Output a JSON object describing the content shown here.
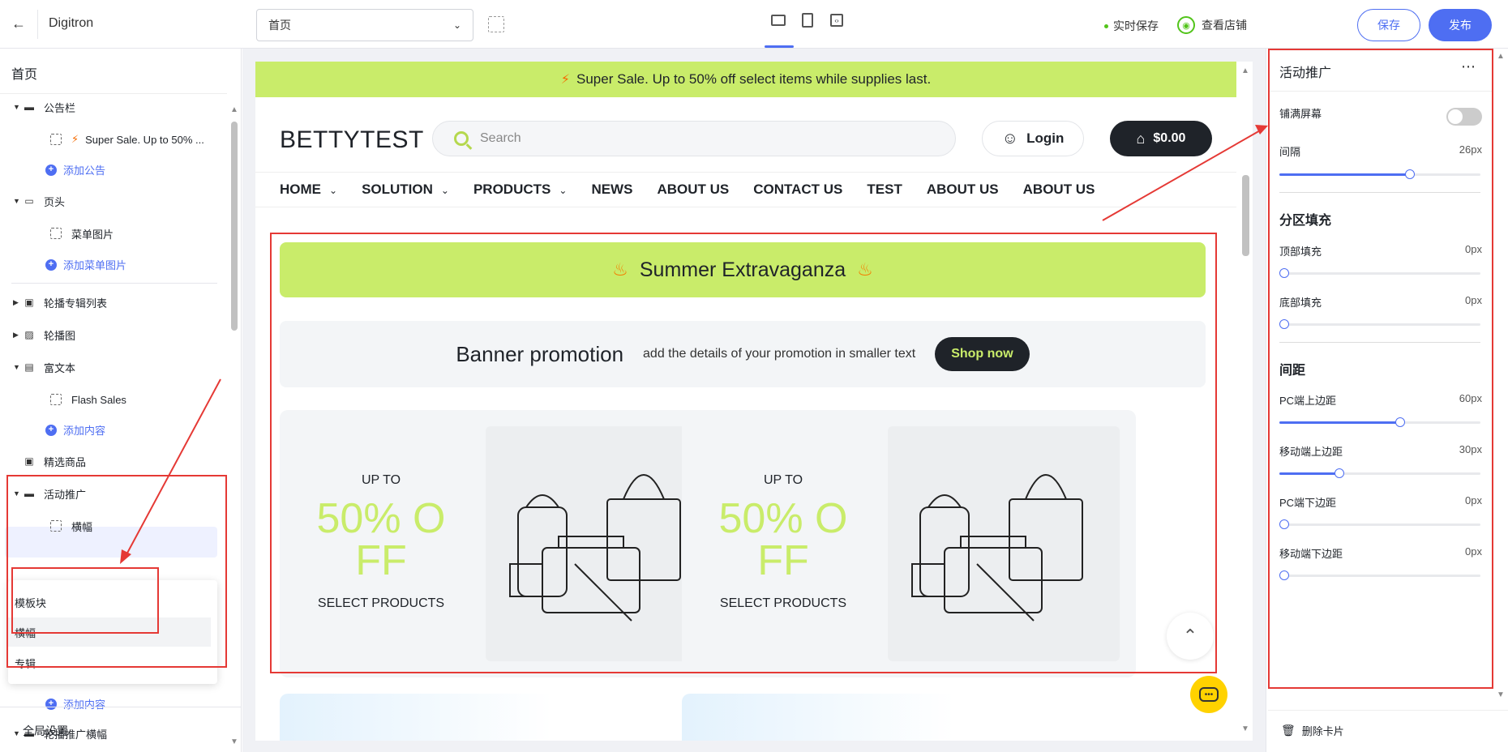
{
  "app": {
    "title": "Digitron"
  },
  "topbar": {
    "page_select": "首页",
    "realtime_save": "实时保存",
    "view_store": "查看店铺",
    "save": "保存",
    "publish": "发布"
  },
  "left": {
    "title": "首页",
    "items": {
      "announcement": "公告栏",
      "announcement_child": "Super Sale. Up to 50% ...",
      "add_announcement": "添加公告",
      "header": "页头",
      "menu_image": "菜单图片",
      "add_menu_image": "添加菜单图片",
      "carousel_album_list": "轮播专辑列表",
      "carousel": "轮播图",
      "rich_text": "富文本",
      "flash_sales": "Flash Sales",
      "add_content_1": "添加内容",
      "featured": "精选商品",
      "promo": "活动推广",
      "banner": "横幅",
      "add_content_2": "添加内容",
      "carousel_banner": "轮播推广横幅"
    },
    "popup": {
      "header": "模板块",
      "option_banner": "横幅",
      "option_album": "专辑"
    },
    "global_settings": "全局设置"
  },
  "preview": {
    "announcement": "Super Sale. Up to 50% off select items while supplies last.",
    "logo": "BETTYTEST",
    "search_placeholder": "Search",
    "login": "Login",
    "cart": "$0.00",
    "nav": [
      "HOME",
      "SOLUTION",
      "PRODUCTS",
      "NEWS",
      "ABOUT US",
      "CONTACT US",
      "TEST",
      "ABOUT US",
      "ABOUT US"
    ],
    "summer": "Summer Extravaganza",
    "banner_title": "Banner promotion",
    "banner_subtitle": "add the details of your promotion in smaller text",
    "shop_now": "Shop now",
    "cards": [
      {
        "upto": "UP TO",
        "pct_line1": "50% O",
        "pct_line2": "FF",
        "select": "SELECT PRODUCTS"
      },
      {
        "upto": "UP TO",
        "pct_line1": "50% O",
        "pct_line2": "FF",
        "select": "SELECT PRODUCTS"
      }
    ]
  },
  "right": {
    "title": "活动推广",
    "fullscreen": "铺满屏幕",
    "gap_label": "间隔",
    "gap_value": "26px",
    "gap_level": 0.65,
    "section_fill": "分区填充",
    "top_fill": "顶部填充",
    "top_fill_value": "0px",
    "top_fill_level": 0,
    "bottom_fill": "底部填充",
    "bottom_fill_value": "0px",
    "bottom_fill_level": 0,
    "section_spacing": "间距",
    "pc_top": "PC端上边距",
    "pc_top_value": "60px",
    "pc_top_level": 0.6,
    "mobile_top": "移动端上边距",
    "mobile_top_value": "30px",
    "mobile_top_level": 0.3,
    "pc_bottom": "PC端下边距",
    "pc_bottom_value": "0px",
    "pc_bottom_level": 0,
    "mobile_bottom": "移动端下边距",
    "mobile_bottom_value": "0px",
    "mobile_bottom_level": 0,
    "delete_card": "删除卡片"
  },
  "colors": {
    "accent": "#4e6ef2",
    "lime": "#c9ec6a",
    "highlight": "#e53935"
  }
}
